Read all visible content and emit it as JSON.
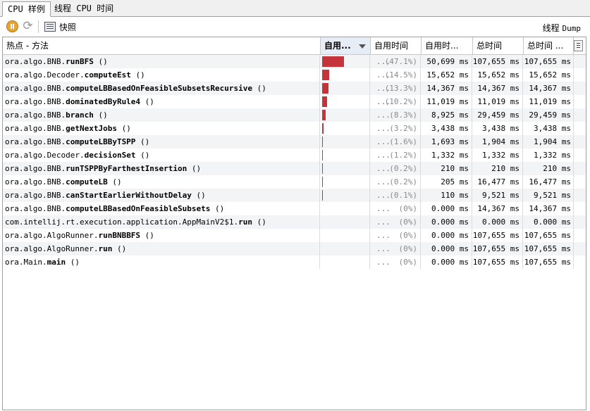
{
  "tabs": [
    "CPU 样例",
    "线程 CPU 时间"
  ],
  "toolbar": {
    "snapshot_label": "快照",
    "thread_dump_label_cn": "线程",
    "thread_dump_label_en": "Dump"
  },
  "columns": [
    "热点 - 方法",
    "自用...",
    "自用时间",
    "自用时...",
    "总时间",
    "总时间 ..."
  ],
  "accent_color": "#c3343b",
  "rows": [
    {
      "prefix": "ora.algo.BNB.",
      "method": "runBFS",
      "suffix": " ()",
      "pct": "(47.1%)",
      "bar": 0.471,
      "self_ms": "50,699 ms",
      "total1": "107,655 ms",
      "total2": "107,655 ms"
    },
    {
      "prefix": "ora.algo.Decoder.",
      "method": "computeEst",
      "suffix": " ()",
      "pct": "(14.5%)",
      "bar": 0.145,
      "self_ms": "15,652 ms",
      "total1": "15,652 ms",
      "total2": "15,652 ms"
    },
    {
      "prefix": "ora.algo.BNB.",
      "method": "computeLBBasedOnFeasibleSubsetsRecursive",
      "suffix": " ()",
      "pct": "(13.3%)",
      "bar": 0.133,
      "self_ms": "14,367 ms",
      "total1": "14,367 ms",
      "total2": "14,367 ms"
    },
    {
      "prefix": "ora.algo.BNB.",
      "method": "dominatedByRule4",
      "suffix": " ()",
      "pct": "(10.2%)",
      "bar": 0.102,
      "self_ms": "11,019 ms",
      "total1": "11,019 ms",
      "total2": "11,019 ms"
    },
    {
      "prefix": "ora.algo.BNB.",
      "method": "branch",
      "suffix": " ()",
      "pct": "(8.3%)",
      "bar": 0.083,
      "self_ms": "8,925 ms",
      "total1": "29,459 ms",
      "total2": "29,459 ms"
    },
    {
      "prefix": "ora.algo.BNB.",
      "method": "getNextJobs",
      "suffix": " ()",
      "pct": "(3.2%)",
      "bar": 0.032,
      "self_ms": "3,438 ms",
      "total1": "3,438 ms",
      "total2": "3,438 ms"
    },
    {
      "prefix": "ora.algo.BNB.",
      "method": "computeLBByTSPP",
      "suffix": " ()",
      "pct": "(1.6%)",
      "bar": 0.016,
      "self_ms": "1,693 ms",
      "total1": "1,904 ms",
      "total2": "1,904 ms"
    },
    {
      "prefix": "ora.algo.Decoder.",
      "method": "decisionSet",
      "suffix": " ()",
      "pct": "(1.2%)",
      "bar": 0.012,
      "self_ms": "1,332 ms",
      "total1": "1,332 ms",
      "total2": "1,332 ms"
    },
    {
      "prefix": "ora.algo.BNB.",
      "method": "runTSPPByFarthestInsertion",
      "suffix": " ()",
      "pct": "(0.2%)",
      "bar": 0.002,
      "self_ms": "210 ms",
      "total1": "210 ms",
      "total2": "210 ms"
    },
    {
      "prefix": "ora.algo.BNB.",
      "method": "computeLB",
      "suffix": " ()",
      "pct": "(0.2%)",
      "bar": 0.002,
      "self_ms": "205 ms",
      "total1": "16,477 ms",
      "total2": "16,477 ms"
    },
    {
      "prefix": "ora.algo.BNB.",
      "method": "canStartEarlierWithoutDelay",
      "suffix": " ()",
      "pct": "(0.1%)",
      "bar": 0.001,
      "self_ms": "110 ms",
      "total1": "9,521 ms",
      "total2": "9,521 ms"
    },
    {
      "prefix": "ora.algo.BNB.",
      "method": "computeLBBasedOnFeasibleSubsets",
      "suffix": " ()",
      "pct": "(0%)",
      "bar": 0,
      "self_ms": "0.000 ms",
      "total1": "14,367 ms",
      "total2": "14,367 ms"
    },
    {
      "prefix": "com.intellij.rt.execution.application.AppMainV2$1.",
      "method": "run",
      "suffix": " ()",
      "pct": "(0%)",
      "bar": 0,
      "self_ms": "0.000 ms",
      "total1": "0.000 ms",
      "total2": "0.000 ms"
    },
    {
      "prefix": "ora.algo.AlgoRunner.",
      "method": "runBNBBFS",
      "suffix": " ()",
      "pct": "(0%)",
      "bar": 0,
      "self_ms": "0.000 ms",
      "total1": "107,655 ms",
      "total2": "107,655 ms"
    },
    {
      "prefix": "ora.algo.AlgoRunner.",
      "method": "run",
      "suffix": " ()",
      "pct": "(0%)",
      "bar": 0,
      "self_ms": "0.000 ms",
      "total1": "107,655 ms",
      "total2": "107,655 ms"
    },
    {
      "prefix": "ora.Main.",
      "method": "main",
      "suffix": " ()",
      "pct": "(0%)",
      "bar": 0,
      "self_ms": "0.000 ms",
      "total1": "107,655 ms",
      "total2": "107,655 ms"
    }
  ]
}
